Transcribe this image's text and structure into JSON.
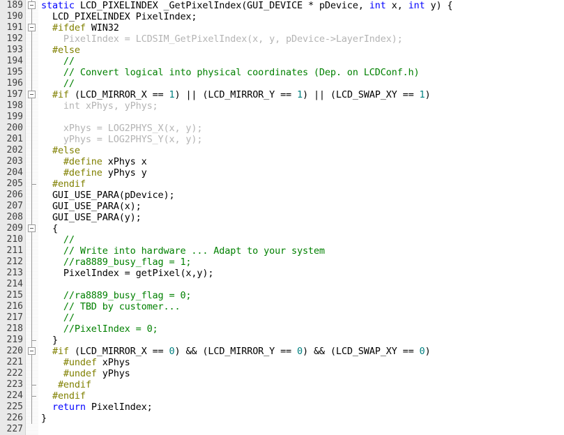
{
  "editor": {
    "language": "c",
    "first_line": 189,
    "last_line": 226,
    "colors": {
      "background": "#ffffff",
      "gutter_background": "#e9e9e9",
      "line_number": "#404040",
      "keyword": "#0000ff",
      "preprocessor": "#808000",
      "comment": "#008000",
      "number": "#008080",
      "plain": "#000000",
      "disabled": "#b4b4b4",
      "fold_line": "#9a9a9a"
    }
  },
  "lines": [
    {
      "n": "189",
      "fold": "box",
      "tokens": [
        {
          "t": "static",
          "c": "t-kw"
        },
        {
          "t": " LCD_PIXELINDEX _GetPixelIndex(GUI_DEVICE * pDevice, ",
          "c": "t-plain"
        },
        {
          "t": "int",
          "c": "t-kw"
        },
        {
          "t": " x, ",
          "c": "t-plain"
        },
        {
          "t": "int",
          "c": "t-kw"
        },
        {
          "t": " y) {",
          "c": "t-plain"
        }
      ]
    },
    {
      "n": "190",
      "fold": "line",
      "tokens": [
        {
          "t": "  LCD_PIXELINDEX PixelIndex;",
          "c": "t-plain"
        }
      ]
    },
    {
      "n": "191",
      "fold": "box",
      "tokens": [
        {
          "t": "  ",
          "c": "t-plain"
        },
        {
          "t": "#ifdef",
          "c": "t-pre"
        },
        {
          "t": " WIN32",
          "c": "t-plain"
        }
      ]
    },
    {
      "n": "192",
      "fold": "line",
      "tokens": [
        {
          "t": "    PixelIndex = LCDSIM_GetPixelIndex(x, y, pDevice->LayerIndex);",
          "c": "t-dis"
        }
      ]
    },
    {
      "n": "193",
      "fold": "line",
      "tokens": [
        {
          "t": "  ",
          "c": "t-plain"
        },
        {
          "t": "#else",
          "c": "t-pre"
        }
      ]
    },
    {
      "n": "194",
      "fold": "line",
      "tokens": [
        {
          "t": "    //",
          "c": "t-com"
        }
      ]
    },
    {
      "n": "195",
      "fold": "line",
      "tokens": [
        {
          "t": "    // Convert logical into physical coordinates (Dep. on LCDConf.h)",
          "c": "t-com"
        }
      ]
    },
    {
      "n": "196",
      "fold": "line",
      "tokens": [
        {
          "t": "    //",
          "c": "t-com"
        }
      ]
    },
    {
      "n": "197",
      "fold": "box",
      "tokens": [
        {
          "t": "  ",
          "c": "t-plain"
        },
        {
          "t": "#if",
          "c": "t-pre"
        },
        {
          "t": " (LCD_MIRROR_X == ",
          "c": "t-plain"
        },
        {
          "t": "1",
          "c": "t-num"
        },
        {
          "t": ") || (LCD_MIRROR_Y == ",
          "c": "t-plain"
        },
        {
          "t": "1",
          "c": "t-num"
        },
        {
          "t": ") || (LCD_SWAP_XY == ",
          "c": "t-plain"
        },
        {
          "t": "1",
          "c": "t-num"
        },
        {
          "t": ")",
          "c": "t-plain"
        }
      ]
    },
    {
      "n": "198",
      "fold": "line",
      "tokens": [
        {
          "t": "    int xPhys, yPhys;",
          "c": "t-dis"
        }
      ]
    },
    {
      "n": "199",
      "fold": "line",
      "tokens": []
    },
    {
      "n": "200",
      "fold": "line",
      "tokens": [
        {
          "t": "    xPhys = LOG2PHYS_X(x, y);",
          "c": "t-dis"
        }
      ]
    },
    {
      "n": "201",
      "fold": "line",
      "tokens": [
        {
          "t": "    yPhys = LOG2PHYS_Y(x, y);",
          "c": "t-dis"
        }
      ]
    },
    {
      "n": "202",
      "fold": "line",
      "tokens": [
        {
          "t": "  ",
          "c": "t-plain"
        },
        {
          "t": "#else",
          "c": "t-pre"
        }
      ]
    },
    {
      "n": "203",
      "fold": "line",
      "tokens": [
        {
          "t": "    ",
          "c": "t-plain"
        },
        {
          "t": "#define",
          "c": "t-pre"
        },
        {
          "t": " xPhys x",
          "c": "t-plain"
        }
      ]
    },
    {
      "n": "204",
      "fold": "line",
      "tokens": [
        {
          "t": "    ",
          "c": "t-plain"
        },
        {
          "t": "#define",
          "c": "t-pre"
        },
        {
          "t": " yPhys y",
          "c": "t-plain"
        }
      ]
    },
    {
      "n": "205",
      "fold": "tick",
      "tokens": [
        {
          "t": "  ",
          "c": "t-plain"
        },
        {
          "t": "#endif",
          "c": "t-pre"
        }
      ]
    },
    {
      "n": "206",
      "fold": "line",
      "tokens": [
        {
          "t": "  GUI_USE_PARA(pDevice);",
          "c": "t-plain"
        }
      ]
    },
    {
      "n": "207",
      "fold": "line",
      "tokens": [
        {
          "t": "  GUI_USE_PARA(x);",
          "c": "t-plain"
        }
      ]
    },
    {
      "n": "208",
      "fold": "line",
      "tokens": [
        {
          "t": "  GUI_USE_PARA(y);",
          "c": "t-plain"
        }
      ]
    },
    {
      "n": "209",
      "fold": "box",
      "tokens": [
        {
          "t": "  {",
          "c": "t-plain"
        }
      ]
    },
    {
      "n": "210",
      "fold": "line",
      "tokens": [
        {
          "t": "    //",
          "c": "t-com"
        }
      ]
    },
    {
      "n": "211",
      "fold": "line",
      "tokens": [
        {
          "t": "    // Write into hardware ... Adapt to your system",
          "c": "t-com"
        }
      ]
    },
    {
      "n": "212",
      "fold": "line",
      "tokens": [
        {
          "t": "    //ra8889_busy_flag = 1;",
          "c": "t-com"
        }
      ]
    },
    {
      "n": "213",
      "fold": "line",
      "tokens": [
        {
          "t": "    PixelIndex = getPixel(x,y);",
          "c": "t-plain"
        }
      ]
    },
    {
      "n": "214",
      "fold": "line",
      "tokens": []
    },
    {
      "n": "215",
      "fold": "line",
      "tokens": [
        {
          "t": "    //ra8889_busy_flag = 0;",
          "c": "t-com"
        }
      ]
    },
    {
      "n": "216",
      "fold": "line",
      "tokens": [
        {
          "t": "    // TBD by customer...",
          "c": "t-com"
        }
      ]
    },
    {
      "n": "217",
      "fold": "line",
      "tokens": [
        {
          "t": "    //",
          "c": "t-com"
        }
      ]
    },
    {
      "n": "218",
      "fold": "line",
      "tokens": [
        {
          "t": "    //PixelIndex = 0;",
          "c": "t-com"
        }
      ]
    },
    {
      "n": "219",
      "fold": "tick",
      "tokens": [
        {
          "t": "  }",
          "c": "t-plain"
        }
      ]
    },
    {
      "n": "220",
      "fold": "box",
      "tokens": [
        {
          "t": "  ",
          "c": "t-plain"
        },
        {
          "t": "#if",
          "c": "t-pre"
        },
        {
          "t": " (LCD_MIRROR_X == ",
          "c": "t-plain"
        },
        {
          "t": "0",
          "c": "t-num"
        },
        {
          "t": ") && (LCD_MIRROR_Y == ",
          "c": "t-plain"
        },
        {
          "t": "0",
          "c": "t-num"
        },
        {
          "t": ") && (LCD_SWAP_XY == ",
          "c": "t-plain"
        },
        {
          "t": "0",
          "c": "t-num"
        },
        {
          "t": ")",
          "c": "t-plain"
        }
      ]
    },
    {
      "n": "221",
      "fold": "line",
      "tokens": [
        {
          "t": "    ",
          "c": "t-plain"
        },
        {
          "t": "#undef",
          "c": "t-pre"
        },
        {
          "t": " xPhys",
          "c": "t-plain"
        }
      ]
    },
    {
      "n": "222",
      "fold": "line",
      "tokens": [
        {
          "t": "    ",
          "c": "t-plain"
        },
        {
          "t": "#undef",
          "c": "t-pre"
        },
        {
          "t": " yPhys",
          "c": "t-plain"
        }
      ]
    },
    {
      "n": "223",
      "fold": "tick",
      "tokens": [
        {
          "t": "   ",
          "c": "t-plain"
        },
        {
          "t": "#endif",
          "c": "t-pre"
        }
      ]
    },
    {
      "n": "224",
      "fold": "tick",
      "tokens": [
        {
          "t": "  ",
          "c": "t-plain"
        },
        {
          "t": "#endif",
          "c": "t-pre"
        }
      ]
    },
    {
      "n": "225",
      "fold": "line",
      "tokens": [
        {
          "t": "  ",
          "c": "t-plain"
        },
        {
          "t": "return",
          "c": "t-kw"
        },
        {
          "t": " PixelIndex;",
          "c": "t-plain"
        }
      ]
    },
    {
      "n": "226",
      "fold": "line",
      "tokens": [
        {
          "t": "}",
          "c": "t-plain"
        }
      ]
    },
    {
      "n": "227",
      "fold": "none",
      "tokens": []
    }
  ]
}
